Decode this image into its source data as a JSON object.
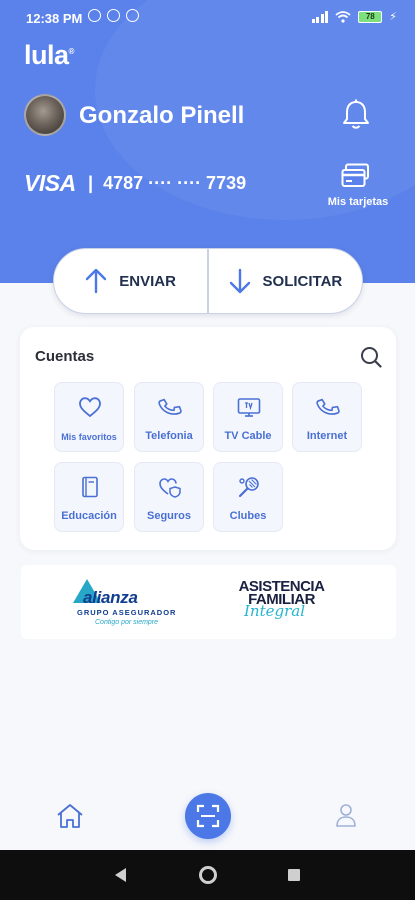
{
  "status_bar": {
    "time": "12:38 PM",
    "battery": "78"
  },
  "app": {
    "logo": "lula",
    "logo_mark": "®"
  },
  "user": {
    "name": "Gonzalo Pinell"
  },
  "card": {
    "brand": "VISA",
    "separator": "|",
    "number": "4787 ···· ···· 7739",
    "my_cards_label": "Mis tarjetas"
  },
  "actions": {
    "send_label": "ENVIAR",
    "request_label": "SOLICITAR"
  },
  "cuentas": {
    "title": "Cuentas",
    "items": [
      {
        "label": "Mis favoritos",
        "icon": "heart-icon"
      },
      {
        "label": "Telefonia",
        "icon": "phone-icon"
      },
      {
        "label": "TV Cable",
        "icon": "tv-icon"
      },
      {
        "label": "Internet",
        "icon": "phone-icon"
      },
      {
        "label": "Educación",
        "icon": "book-icon"
      },
      {
        "label": "Seguros",
        "icon": "shield-heart-icon"
      },
      {
        "label": "Clubes",
        "icon": "racket-icon"
      }
    ]
  },
  "banner": {
    "alianza_name": "alianza",
    "alianza_sub": "GRUPO ASEGURADOR",
    "alianza_slogan": "Contigo por siempre",
    "asistencia_line1": "ASISTENCIA",
    "asistencia_line2": "FAMILIAR",
    "asistencia_line3": "Integral"
  },
  "colors": {
    "primary": "#5b82ea",
    "accent_text": "#4a70d4",
    "dark_text": "#22304f"
  }
}
